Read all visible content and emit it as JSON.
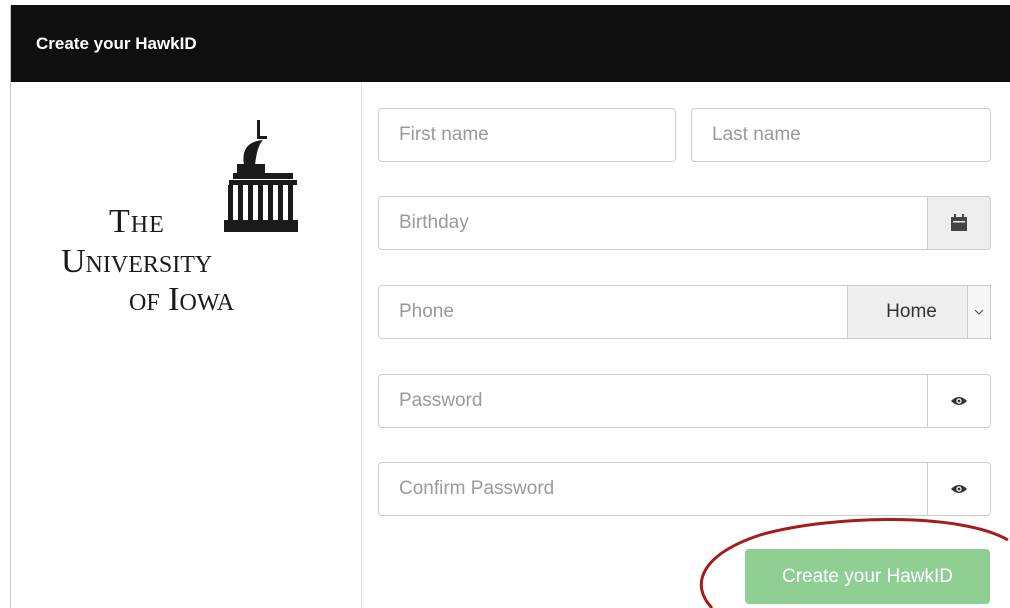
{
  "header": {
    "title": "Create your HawkID"
  },
  "logo": {
    "line1": "The",
    "line2": "University",
    "line3": "of Iowa"
  },
  "form": {
    "first_name_placeholder": "First name",
    "last_name_placeholder": "Last name",
    "birthday_placeholder": "Birthday",
    "phone_placeholder": "Phone",
    "phone_type_selected": "Home",
    "password_placeholder": "Password",
    "confirm_password_placeholder": "Confirm Password",
    "submit_label": "Create your HawkID"
  },
  "icons": {
    "calendar": "calendar-icon",
    "eye": "eye-icon",
    "caret": "chevron-down-icon"
  },
  "colors": {
    "header_bg": "#0f0f0f",
    "submit_bg": "#8fcf94",
    "highlight_ring": "#a41c1c"
  }
}
